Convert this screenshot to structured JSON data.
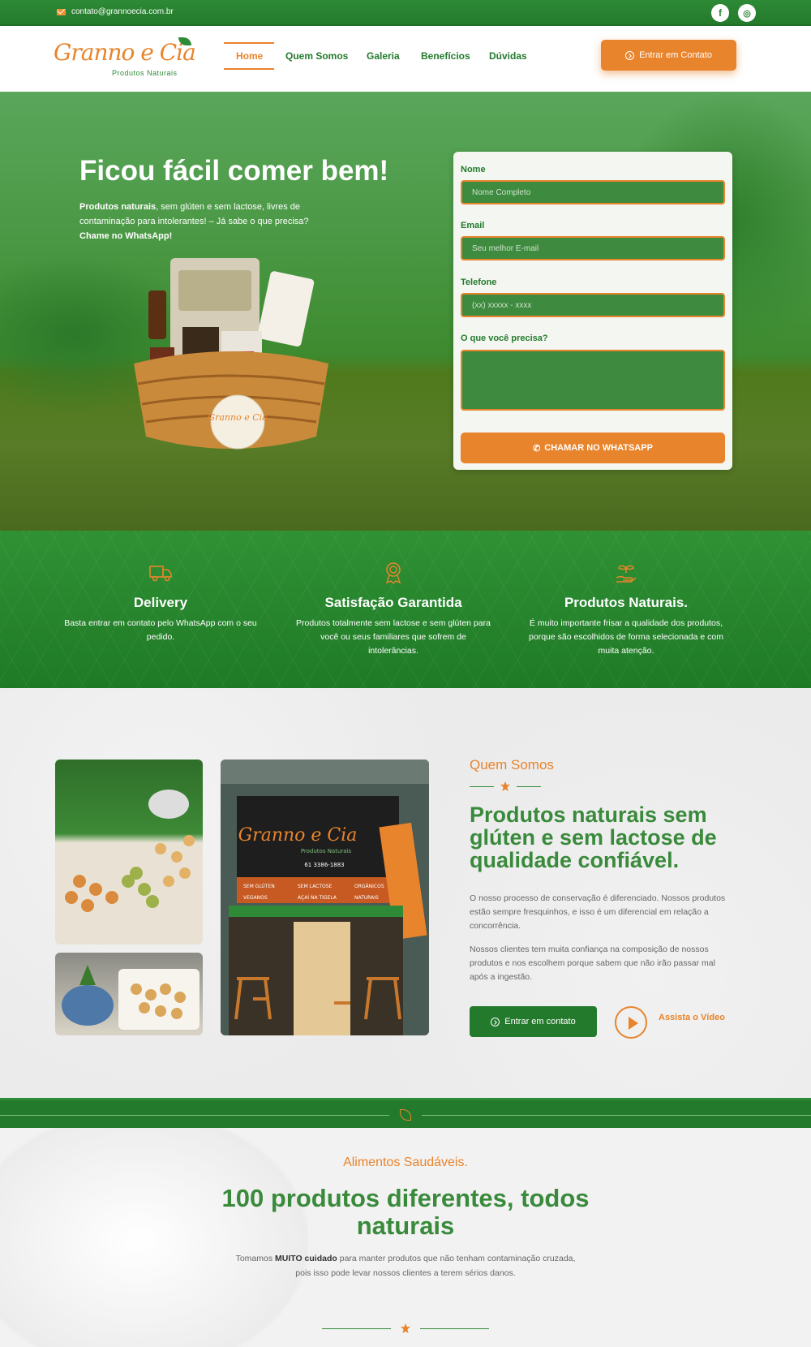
{
  "topbar": {
    "email": "contato@grannoecia.com.br",
    "facebook_icon": "f",
    "instagram_icon": "◎"
  },
  "header": {
    "logo_main": "Granno e Cia",
    "logo_sub": "Produtos Naturais",
    "nav": [
      "Home",
      "Quem Somos",
      "Galeria",
      "Benefícios",
      "Dúvidas"
    ],
    "cta": "Entrar em Contato"
  },
  "hero": {
    "title": "Ficou fácil comer bem!",
    "subtitle_bold": "Produtos naturais",
    "subtitle_rest": ", sem glúten e sem lactose, livres de contaminação para intolerantes! – Já sabe o que precisa?",
    "subtitle_cta": "Chame no WhatsApp!",
    "basket_label": "Granno e Cia"
  },
  "form": {
    "name_label": "Nome",
    "name_placeholder": "Nome Completo",
    "email_label": "Email",
    "email_placeholder": "Seu melhor E-mail",
    "phone_label": "Telefone",
    "phone_placeholder": "(xx) xxxxx - xxxx",
    "need_label": "O que você precisa?",
    "submit": "CHAMAR NO WHATSAPP"
  },
  "features": [
    {
      "icon": "truck-icon",
      "title": "Delivery",
      "text": "Basta entrar em contato pelo WhatsApp com o seu pedido."
    },
    {
      "icon": "award-icon",
      "title": "Satisfação Garantida",
      "text": "Produtos totalmente sem lactose e sem glúten para você ou seus familiares que sofrem de intolerâncias."
    },
    {
      "icon": "plant-hand-icon",
      "title": "Produtos Naturais.",
      "text": "É muito importante frisar a qualidade dos produtos, porque são escolhidos de forma selecionada e com muita atenção."
    }
  ],
  "about": {
    "section": "Quem Somos",
    "title": "Produtos naturais sem glúten e sem lactose de qualidade confiável.",
    "p1": "O nosso processo de conservação é diferenciado. Nossos produtos estão sempre fresquinhos, e isso é um diferencial em relação a concorrência.",
    "p2": "Nossos clientes tem muita confiança na composição de nossos produtos e nos escolhem porque sabem que não irão passar mal após a ingestão.",
    "cta": "Entrar em contato",
    "video": "Assista o Vídeo",
    "store_sign": "Granno e Cia",
    "store_sign_sub": "Produtos Naturais",
    "store_phone": "61 3386-1883",
    "store_tags": [
      "SEM GLÚTEN",
      "SEM LACTOSE",
      "ORGÂNICOS",
      "VEGANOS",
      "AÇAÍ NA TIGELA",
      "NATURAIS"
    ]
  },
  "products": {
    "section": "Alimentos Saudáveis.",
    "title": "100 produtos diferentes, todos naturais",
    "text_pre": "Tomamos ",
    "text_bold": "MUITO cuidado",
    "text_post": " para manter produtos que não tenham contaminação cruzada, pois isso pode levar nossos clientes a terem sérios danos."
  },
  "colors": {
    "green": "#237a2c",
    "orange": "#e8842c",
    "title_green": "#3a8a3c"
  }
}
